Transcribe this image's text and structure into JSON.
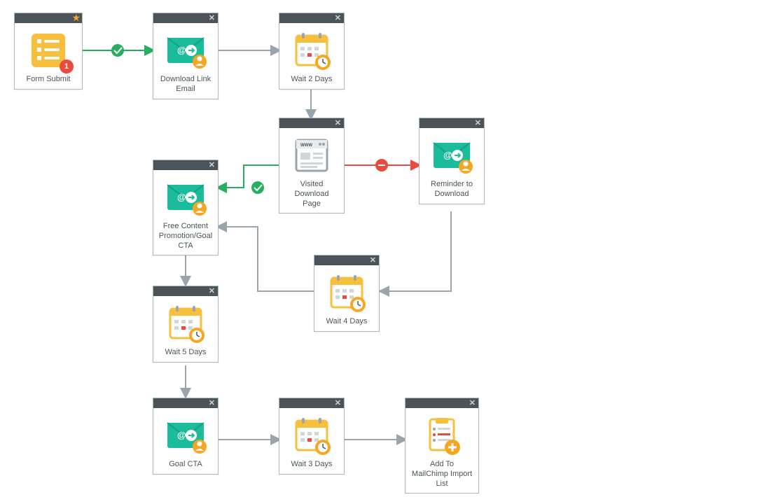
{
  "nodes": {
    "form_submit": {
      "label": "Form Submit",
      "badge": "1"
    },
    "download_link_email": {
      "label": "Download Link Email"
    },
    "wait_2_days": {
      "label": "Wait 2 Days"
    },
    "visited_download_page": {
      "label": "Visited Download Page"
    },
    "reminder_to_download": {
      "label": "Reminder to Download"
    },
    "free_content_promotion": {
      "label": "Free Content Promotion/Goal CTA"
    },
    "wait_4_days": {
      "label": "Wait 4 Days"
    },
    "wait_5_days": {
      "label": "Wait 5 Days"
    },
    "goal_cta": {
      "label": "Goal CTA"
    },
    "wait_3_days": {
      "label": "Wait 3 Days"
    },
    "add_to_mailchimp": {
      "label": "Add To MailChimp Import List"
    }
  },
  "icons": {
    "form": "form-icon",
    "email": "email-icon",
    "calendar": "calendar-clock-icon",
    "webpage": "webpage-icon",
    "list": "list-plus-icon"
  },
  "colors": {
    "teal": "#1abc9c",
    "orange": "#f5a623",
    "amber": "#f8bf3c",
    "red": "#e74c3c",
    "green": "#27ae60",
    "gray": "#9aa5ab",
    "dark": "#4a5459"
  }
}
